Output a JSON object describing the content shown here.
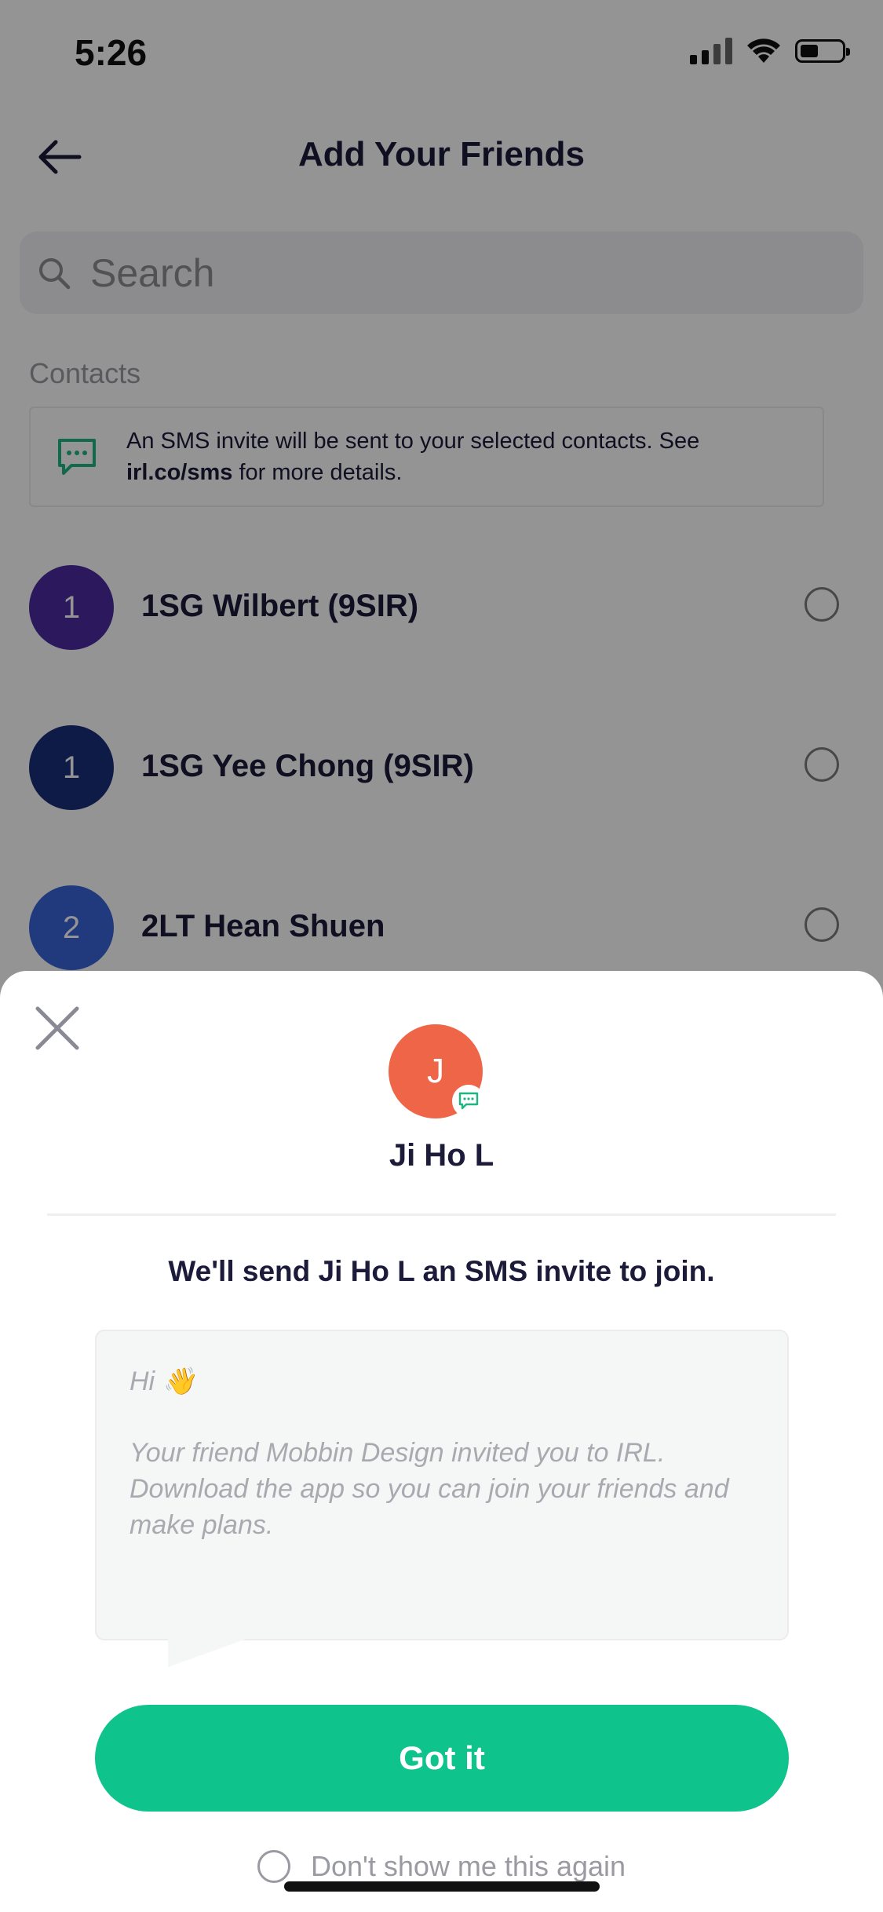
{
  "status_bar": {
    "time": "5:26"
  },
  "nav": {
    "title": "Add Your Friends"
  },
  "search": {
    "placeholder": "Search"
  },
  "contacts_section": {
    "label": "Contacts",
    "info_text_prefix": "An SMS invite will be sent to your selected contacts. See ",
    "info_link": "irl.co/sms",
    "info_text_suffix": " for more details."
  },
  "contacts": [
    {
      "initial": "1",
      "name": "1SG Wilbert (9SIR)",
      "color": "#4a2aa0"
    },
    {
      "initial": "1",
      "name": "1SG Yee Chong (9SIR)",
      "color": "#1a2f7a"
    },
    {
      "initial": "2",
      "name": "2LT Hean Shuen",
      "color": "#3a64d8"
    }
  ],
  "sheet": {
    "avatar_initial": "J",
    "name": "Ji Ho L",
    "message": "We'll send Ji Ho L an SMS invite to join.",
    "bubble_greeting": "Hi 👋",
    "bubble_body": "Your friend Mobbin Design invited you to IRL. Download the app so you can join your friends and make plans.",
    "confirm_label": "Got it",
    "dont_show_label": "Don't show me this again"
  },
  "colors": {
    "accent_green": "#0fc38d",
    "avatar_orange": "#ef6548",
    "text_dark": "#1d1b3a"
  },
  "icons": [
    "back-arrow-icon",
    "search-icon",
    "sms-icon",
    "close-icon",
    "sms-badge-icon"
  ]
}
